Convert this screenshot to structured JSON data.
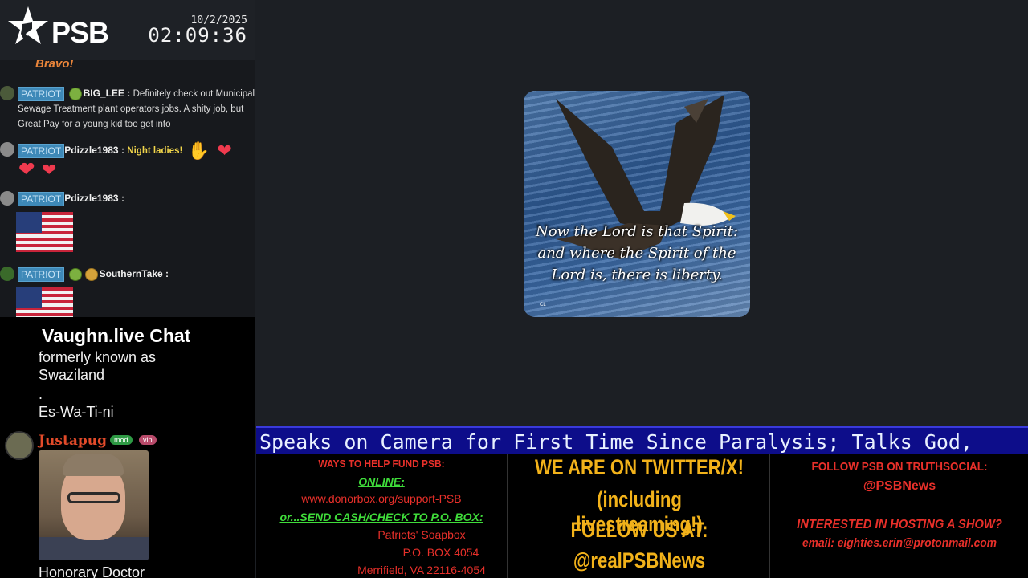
{
  "header": {
    "logo_text": "PSB",
    "date": "10/2/2025",
    "clock": "02:09:36"
  },
  "feed": {
    "partial_message": "Bravo!",
    "messages": [
      {
        "badge": "PATRIOT",
        "user": "BIG_LEE",
        "separator": ":",
        "text": "Definitely check out Municipal Sewage Treatment plant operators jobs. A shity job, but Great Pay for a young kid too get into"
      },
      {
        "badge": "PATRIOT",
        "user": "Pdizzle1983",
        "separator": ":",
        "text": "Night ladies!"
      },
      {
        "badge": "PATRIOT",
        "user": "Pdizzle1983",
        "separator": ":",
        "text": ""
      },
      {
        "badge": "PATRIOT",
        "user": "SouthernTake",
        "separator": ":",
        "text": ""
      }
    ]
  },
  "chat": {
    "title": "Vaughn.live Chat",
    "lines": [
      "formerly known as",
      "Swaziland",
      ".",
      "Es-Wa-Ti-ni"
    ],
    "user": "Justapug",
    "badges": [
      "mod",
      "vip"
    ],
    "caption": "Honorary Doctor"
  },
  "main": {
    "quote": "Now the Lord is that Spirit: and where the Spirit of the Lord is, there is liberty.",
    "watermark": "CL"
  },
  "ticker": {
    "text": "Speaks on Camera for First Time Since Paralysis; Talks God,"
  },
  "fund": {
    "title": "WAYS TO HELP FUND PSB:",
    "online_label": "ONLINE:",
    "online_url": "www.donorbox.org/support-PSB",
    "or_label": "or...SEND CASH/CHECK TO P.O. BOX:",
    "address_line1": "Patriots' Soapbox",
    "address_line2": "P.O. BOX 4054",
    "address_line3": "Merrifield, VA 22116-4054"
  },
  "twitter": {
    "line1": "WE ARE ON TWITTER/X!",
    "line2": "(including livestreaming!)",
    "line3": "FOLLOW US AT:",
    "line4": "@realPSBNews"
  },
  "truth": {
    "line1": "FOLLOW PSB ON TRUTHSOCIAL:",
    "line2": "@PSBNews",
    "line3": "INTERESTED IN HOSTING A SHOW?",
    "line4": "email: eighties.erin@protonmail.com"
  },
  "colors": {
    "badge": "#3e89b8",
    "ticker_bg": "#0d0d8a",
    "fund_red": "#e8302a",
    "fund_green": "#3fdc3a",
    "twitter_gold": "#f2b21a"
  }
}
